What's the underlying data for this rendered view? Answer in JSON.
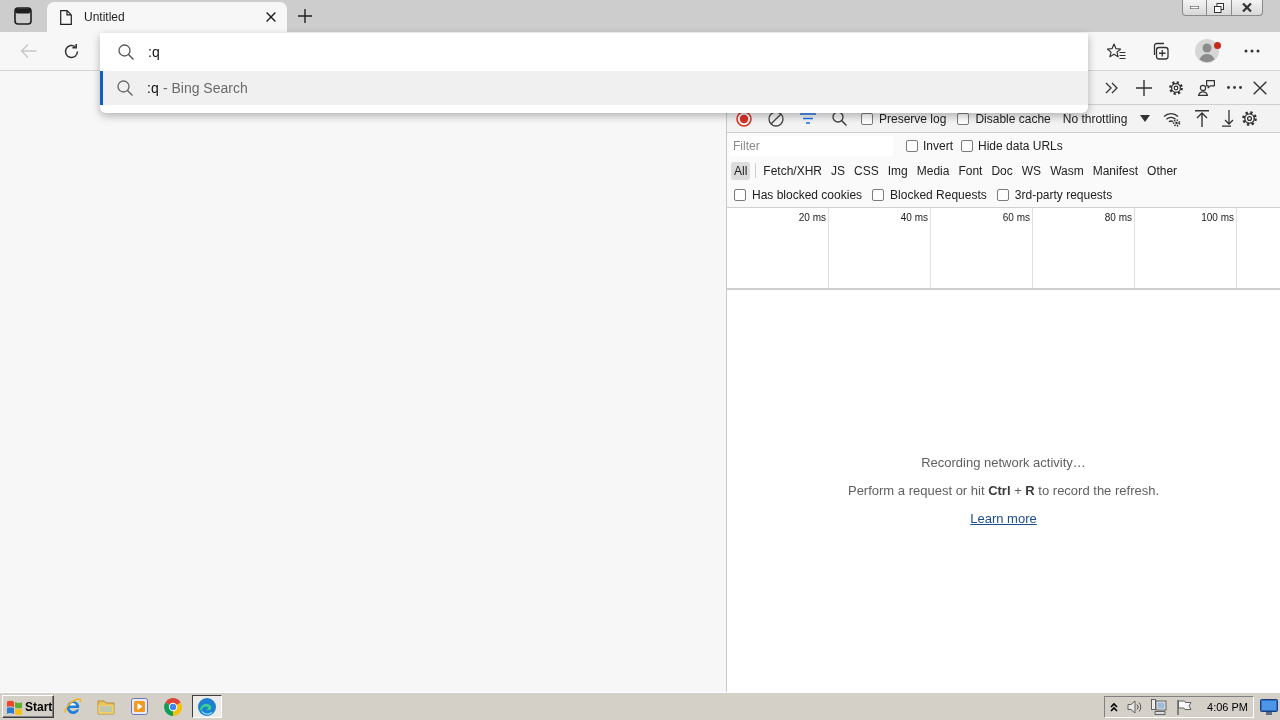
{
  "tab_strip": {
    "tabs": [
      {
        "title": "Untitled",
        "selected": true
      }
    ]
  },
  "toolbar": {
    "back": {
      "disabled": true
    },
    "profile": {
      "alert": true
    }
  },
  "omnibox": {
    "value": ":q",
    "suggestions": [
      {
        "query": ":q",
        "suffix": "- Bing Search",
        "selected": true
      }
    ]
  },
  "devtools": {
    "network_toolbar": {
      "recording": true,
      "filter_on": true,
      "options": [
        {
          "label": "Preserve log",
          "checked": false
        },
        {
          "label": "Disable cache",
          "checked": false
        }
      ],
      "throttling": "No throttling"
    },
    "filter": {
      "placeholder": "Filter",
      "options": [
        {
          "label": "Invert",
          "checked": false
        },
        {
          "label": "Hide data URLs",
          "checked": false
        }
      ]
    },
    "types": [
      {
        "label": "All",
        "selected": true
      },
      {
        "label": "Fetch/XHR",
        "selected": false
      },
      {
        "label": "JS",
        "selected": false
      },
      {
        "label": "CSS",
        "selected": false
      },
      {
        "label": "Img",
        "selected": false
      },
      {
        "label": "Media",
        "selected": false
      },
      {
        "label": "Font",
        "selected": false
      },
      {
        "label": "Doc",
        "selected": false
      },
      {
        "label": "WS",
        "selected": false
      },
      {
        "label": "Wasm",
        "selected": false
      },
      {
        "label": "Manifest",
        "selected": false
      },
      {
        "label": "Other",
        "selected": false
      }
    ],
    "request_filters": [
      {
        "label": "Has blocked cookies",
        "checked": false
      },
      {
        "label": "Blocked Requests",
        "checked": false
      },
      {
        "label": "3rd-party requests",
        "checked": false
      }
    ],
    "overview": {
      "ticks": [
        "20 ms",
        "40 ms",
        "60 ms",
        "80 ms",
        "100 ms"
      ]
    },
    "empty_state": {
      "title": "Recording network activity…",
      "hint": "Perform a request or hit **Ctrl** + **R** to record the refresh.",
      "link": "Learn more"
    }
  },
  "taskbar": {
    "start": "Start",
    "apps": [
      {
        "selected": false
      },
      {
        "selected": false
      },
      {
        "selected": false
      },
      {
        "selected": false
      },
      {
        "selected": true
      }
    ],
    "clock": "4:06 PM"
  }
}
